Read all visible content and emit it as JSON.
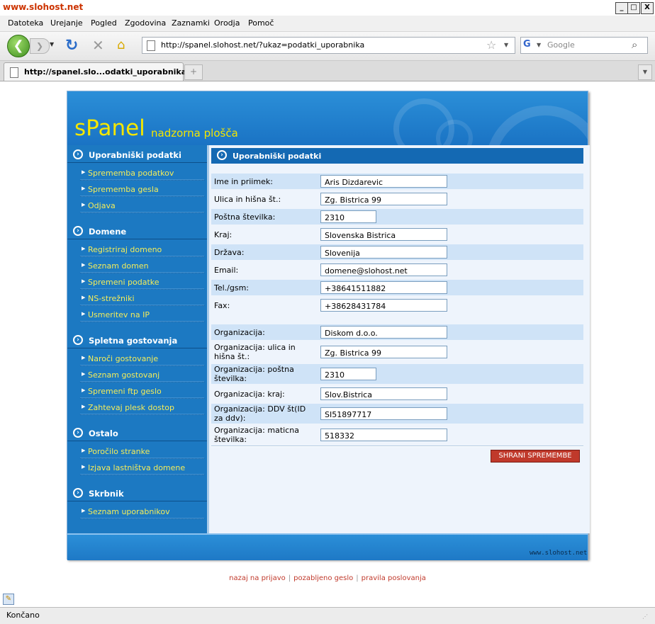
{
  "window": {
    "title": "www.slohost.net",
    "buttons": [
      "_",
      "□",
      "X"
    ]
  },
  "menu": [
    "Datoteka",
    "Urejanje",
    "Pogled",
    "Zgodovina",
    "Zaznamki",
    "Orodja",
    "Pomoč"
  ],
  "nav": {
    "url": "http://spanel.slohost.net/?ukaz=podatki_uporabnika",
    "search_placeholder": "Google"
  },
  "tab": {
    "title": "http://spanel.slo...odatki_uporabnika"
  },
  "header": {
    "logo": "sPanel",
    "subtitle": "nadzorna plošča"
  },
  "sidebar": {
    "sections": [
      {
        "label": "Uporabniški podatki",
        "links": [
          "Sprememba podatkov",
          "Sprememba gesla",
          "Odjava"
        ]
      },
      {
        "label": "Domene",
        "links": [
          "Registriraj domeno",
          "Seznam domen",
          "Spremeni podatke",
          "NS-strežniki",
          "Usmeritev na IP"
        ]
      },
      {
        "label": "Spletna gostovanja",
        "links": [
          "Naroči gostovanje",
          "Seznam gostovanj",
          "Spremeni ftp geslo",
          "Zahtevaj plesk dostop"
        ]
      },
      {
        "label": "Ostalo",
        "links": [
          "Poročilo stranke",
          "Izjava lastništva domene"
        ]
      },
      {
        "label": "Skrbnik",
        "links": [
          "Seznam uporabnikov"
        ]
      }
    ]
  },
  "content": {
    "title": "Uporabniški podatki",
    "fields": [
      {
        "label": "Ime in priimek:",
        "value": "Aris Dizdarevic"
      },
      {
        "label": "Ulica in hišna št.:",
        "value": "Zg. Bistrica 99"
      },
      {
        "label": "Poštna številka:",
        "value": "2310"
      },
      {
        "label": "Kraj:",
        "value": "Slovenska Bistrica"
      },
      {
        "label": "Država:",
        "value": "Slovenija"
      },
      {
        "label": "Email:",
        "value": "domene@slohost.net"
      },
      {
        "label": "Tel./gsm:",
        "value": "+38641511882"
      },
      {
        "label": "Fax:",
        "value": "+38628431784"
      },
      {
        "label": "Organizacija:",
        "value": "Diskom d.o.o."
      },
      {
        "label": "Organizacija: ulica in hišna št.:",
        "value": "Zg. Bistrica 99"
      },
      {
        "label": "Organizacija: poštna številka:",
        "value": "2310"
      },
      {
        "label": "Organizacija: kraj:",
        "value": "Slov.Bistrica"
      },
      {
        "label": "Organizacija: DDV št(ID za ddv):",
        "value": "SI51897717"
      },
      {
        "label": "Organizacija: maticna številka:",
        "value": "518332"
      }
    ],
    "save_label": "SHRANI SPREMEMBE"
  },
  "footer": {
    "site": "www.slohost.net"
  },
  "bottom_links": [
    "nazaj na prijavo",
    "pozabljeno geslo",
    "pravila poslovanja"
  ],
  "status": "Končano",
  "colors": {
    "header_blue": "#1a73c4",
    "link_yellow": "#f3ec5a",
    "save_red": "#c0392b"
  }
}
